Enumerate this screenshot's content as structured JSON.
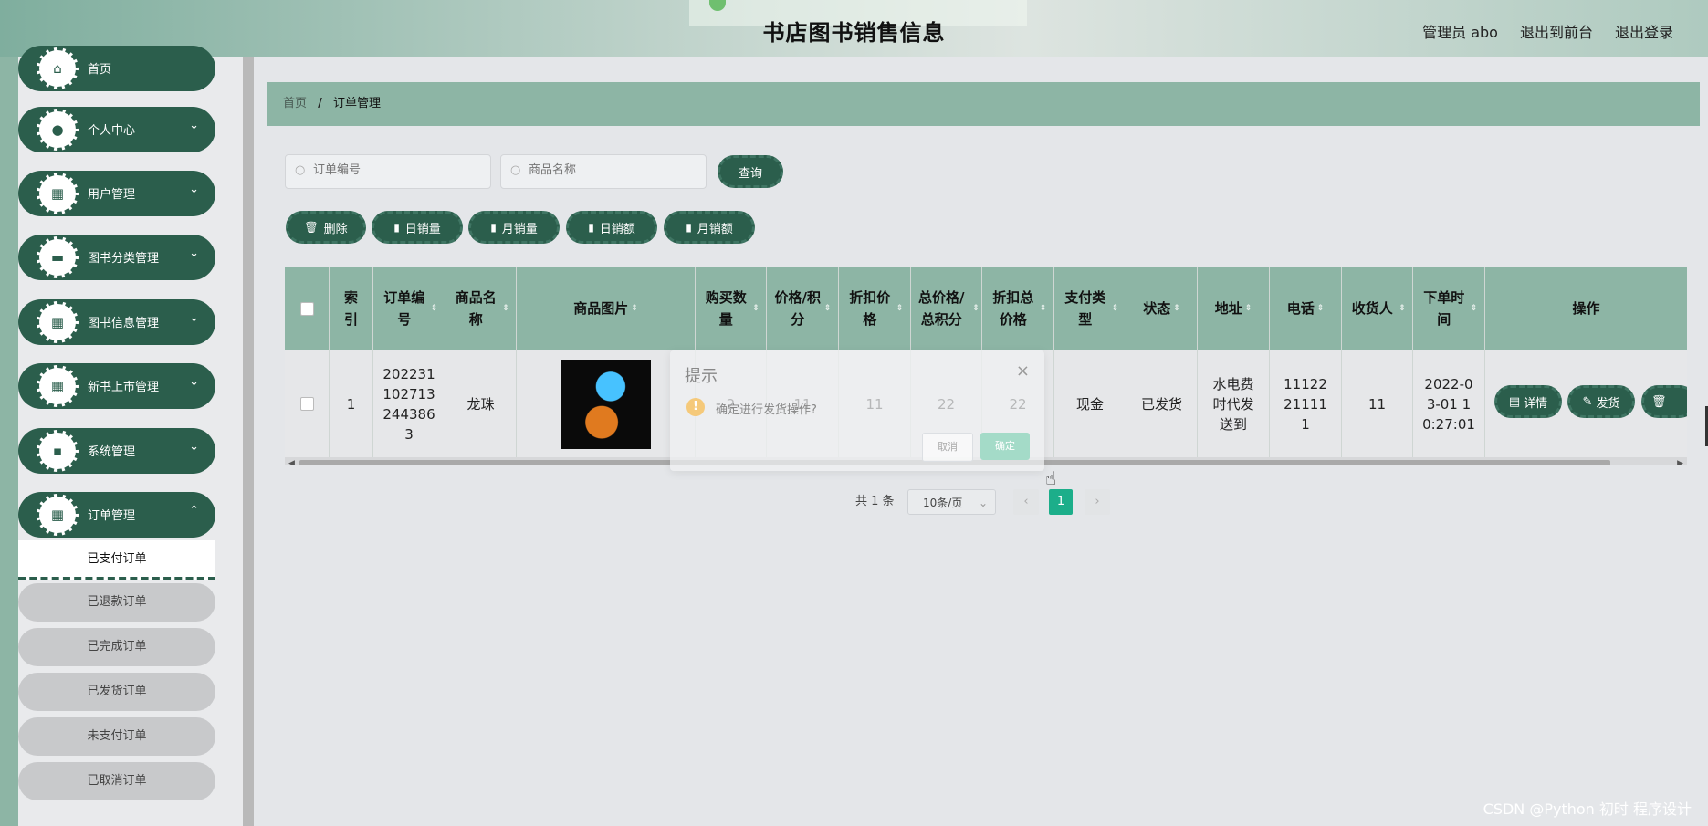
{
  "header": {
    "title": "书店图书销售信息",
    "user_label": "管理员 abo",
    "to_front": "退出到前台",
    "logout": "退出登录"
  },
  "sidebar": {
    "items": [
      {
        "label": "首页",
        "icon": "home-icon"
      },
      {
        "label": "个人中心",
        "icon": "user-icon"
      },
      {
        "label": "用户管理",
        "icon": "grid-icon"
      },
      {
        "label": "图书分类管理",
        "icon": "briefcase-icon"
      },
      {
        "label": "图书信息管理",
        "icon": "grid-icon"
      },
      {
        "label": "新书上市管理",
        "icon": "grid-icon"
      },
      {
        "label": "系统管理",
        "icon": "chat-icon"
      },
      {
        "label": "订单管理",
        "icon": "grid-icon"
      }
    ],
    "sub_items": [
      "已支付订单",
      "已退款订单",
      "已完成订单",
      "已发货订单",
      "未支付订单",
      "已取消订单"
    ],
    "active_sub": "已支付订单"
  },
  "breadcrumb": {
    "home": "首页",
    "separator": "/",
    "current": "订单管理"
  },
  "search": {
    "order_placeholder": "订单编号",
    "product_placeholder": "商品名称",
    "query_button": "查询"
  },
  "toolbar": {
    "delete": "删除",
    "daily_sales_qty": "日销量",
    "monthly_sales_qty": "月销量",
    "daily_sales_amt": "日销额",
    "monthly_sales_amt": "月销额"
  },
  "table": {
    "headers": {
      "index": "索引",
      "order_no": "订单编号",
      "product_name": "商品名称",
      "product_image": "商品图片",
      "qty": "购买数量",
      "price": "价格/积分",
      "discount_price": "折扣价格",
      "total": "总价格/总积分",
      "discount_total": "折扣总价格",
      "pay_type": "支付类型",
      "status": "状态",
      "address": "地址",
      "phone": "电话",
      "receiver": "收货人",
      "order_time": "下单时间",
      "actions": "操作"
    },
    "rows": [
      {
        "index": "1",
        "order_no": "2022311027132443863",
        "product_name": "龙珠",
        "qty": "2",
        "price": "11",
        "discount_price": "11",
        "total": "22",
        "discount_total": "22",
        "pay_type": "现金",
        "status": "已发货",
        "address": "水电费时代发送到",
        "phone": "11122211111",
        "receiver": "11",
        "order_time": "2022-03-01 10:27:01"
      }
    ],
    "row_actions": {
      "detail": "详情",
      "ship": "发货"
    }
  },
  "pagination": {
    "total": "共 1 条",
    "page_size": "10条/页",
    "current_page": "1"
  },
  "dialog": {
    "title": "提示",
    "message": "确定进行发货操作?",
    "cancel": "取消",
    "confirm": "确定"
  },
  "watermark": "CSDN @Python 初时 程序设计",
  "colors": {
    "primary": "#2b5e4c",
    "header_green": "#8db5a5",
    "active_page": "#1cae8a"
  }
}
